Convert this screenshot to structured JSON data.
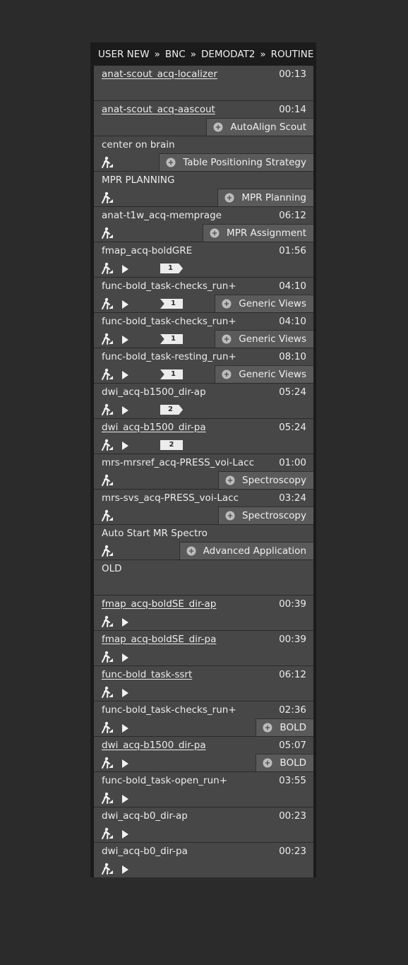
{
  "breadcrumb": {
    "items": [
      "USER NEW",
      "BNC",
      "DEMODAT2",
      "ROUTINE"
    ],
    "separator": "»"
  },
  "rows": [
    {
      "name": "anat-scout_acq-localizer",
      "underline": true,
      "time": "00:13",
      "icons": [],
      "tag": null,
      "badge": null
    },
    {
      "name": "anat-scout_acq-aascout",
      "underline": true,
      "time": "00:14",
      "icons": [],
      "tag": null,
      "badge": "AutoAlign Scout"
    },
    {
      "name": "center on brain",
      "underline": false,
      "time": "",
      "icons": [
        "worker"
      ],
      "tag": null,
      "badge": "Table Positioning Strategy"
    },
    {
      "name": "MPR PLANNING",
      "underline": false,
      "time": "",
      "icons": [
        "worker"
      ],
      "tag": null,
      "badge": "MPR Planning"
    },
    {
      "name": "anat-t1w_acq-memprage",
      "underline": false,
      "time": "06:12",
      "icons": [
        "worker"
      ],
      "tag": null,
      "badge": "MPR Assignment"
    },
    {
      "name": "fmap_acq-boldGRE",
      "underline": false,
      "time": "01:56",
      "icons": [
        "worker",
        "play"
      ],
      "tag": {
        "label": "1",
        "shape": "right"
      },
      "badge": null
    },
    {
      "name": "func-bold_task-checks_run+",
      "underline": false,
      "time": "04:10",
      "icons": [
        "worker",
        "play"
      ],
      "tag": {
        "label": "1",
        "shape": "left"
      },
      "badge": "Generic Views"
    },
    {
      "name": "func-bold_task-checks_run+",
      "underline": false,
      "time": "04:10",
      "icons": [
        "worker",
        "play"
      ],
      "tag": {
        "label": "1",
        "shape": "left"
      },
      "badge": "Generic Views"
    },
    {
      "name": "func-bold_task-resting_run+",
      "underline": false,
      "time": "08:10",
      "icons": [
        "worker",
        "play"
      ],
      "tag": {
        "label": "1",
        "shape": "left"
      },
      "badge": "Generic Views"
    },
    {
      "name": "dwi_acq-b1500_dir-ap",
      "underline": false,
      "time": "05:24",
      "icons": [
        "worker",
        "play"
      ],
      "tag": {
        "label": "2",
        "shape": "right"
      },
      "badge": null
    },
    {
      "name": "dwi_acq-b1500_dir-pa",
      "underline": true,
      "time": "05:24",
      "icons": [
        "worker",
        "play"
      ],
      "tag": {
        "label": "2",
        "shape": "rect"
      },
      "badge": null
    },
    {
      "name": "mrs-mrsref_acq-PRESS_voi-Lacc",
      "underline": false,
      "time": "01:00",
      "icons": [
        "worker"
      ],
      "tag": null,
      "badge": "Spectroscopy"
    },
    {
      "name": "mrs-svs_acq-PRESS_voi-Lacc",
      "underline": false,
      "time": "03:24",
      "icons": [
        "worker"
      ],
      "tag": null,
      "badge": "Spectroscopy"
    },
    {
      "name": "Auto Start MR Spectro",
      "underline": false,
      "time": "",
      "icons": [
        "worker"
      ],
      "tag": null,
      "badge": "Advanced Application"
    },
    {
      "name": "OLD",
      "underline": false,
      "time": "",
      "icons": [],
      "tag": null,
      "badge": null
    },
    {
      "name": "fmap_acq-boldSE_dir-ap",
      "underline": true,
      "time": "00:39",
      "icons": [
        "worker",
        "play"
      ],
      "tag": null,
      "badge": null
    },
    {
      "name": "fmap_acq-boldSE_dir-pa",
      "underline": true,
      "time": "00:39",
      "icons": [
        "worker",
        "play"
      ],
      "tag": null,
      "badge": null
    },
    {
      "name": "func-bold_task-ssrt",
      "underline": true,
      "time": "06:12",
      "icons": [
        "worker",
        "play"
      ],
      "tag": null,
      "badge": null
    },
    {
      "name": "func-bold_task-checks_run+",
      "underline": false,
      "time": "02:36",
      "icons": [
        "worker",
        "play"
      ],
      "tag": null,
      "badge": "BOLD"
    },
    {
      "name": "dwi_acq-b1500_dir-pa",
      "underline": true,
      "time": "05:07",
      "icons": [
        "worker",
        "play"
      ],
      "tag": null,
      "badge": "BOLD"
    },
    {
      "name": "func-bold_task-open_run+",
      "underline": false,
      "time": "03:55",
      "icons": [
        "worker",
        "play"
      ],
      "tag": null,
      "badge": null
    },
    {
      "name": "dwi_acq-b0_dir-ap",
      "underline": false,
      "time": "00:23",
      "icons": [
        "worker",
        "play"
      ],
      "tag": null,
      "badge": null
    },
    {
      "name": "dwi_acq-b0_dir-pa",
      "underline": false,
      "time": "00:23",
      "icons": [
        "worker",
        "play"
      ],
      "tag": null,
      "badge": null
    }
  ],
  "icon_names": {
    "worker": "manual-worker-icon",
    "play": "play-icon",
    "plus": "plus-circle-icon"
  },
  "colors": {
    "row": "#474747",
    "badge": "#5a5a5a",
    "text": "#ececec"
  }
}
